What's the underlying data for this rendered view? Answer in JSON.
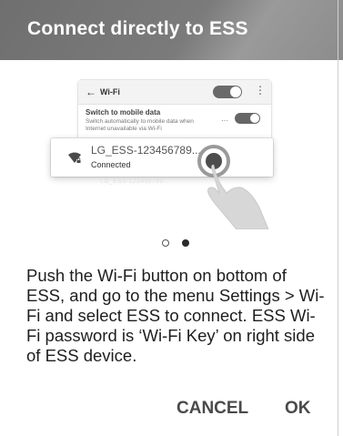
{
  "dialog": {
    "title": "Connect directly to ESS",
    "message": "Push the Wi-Fi button on bottom of ESS, and go to the menu Settings > Wi-Fi and select ESS to connect. ESS Wi-Fi password is ‘Wi-Fi Key’ on right side of ESS device.",
    "cancel_label": "CANCEL",
    "ok_label": "OK"
  },
  "illustration": {
    "wifi_header": "Wi-Fi",
    "back_icon": "←",
    "more_icon": "⋮",
    "mobile_data_title": "Switch to mobile data",
    "mobile_data_desc": "Switch automatically to mobile data when Internet unavailable via Wi-Fi",
    "ellipsis": "···",
    "network_name": "LG_ESS-123456789...",
    "network_status": "Connected",
    "ghost_network": "LG_ESS-123456789..."
  },
  "pager": {
    "total": 2,
    "current": 2
  },
  "colors": {
    "header": "#777777",
    "text": "#1e1e1e",
    "button": "#4a4a4a"
  }
}
